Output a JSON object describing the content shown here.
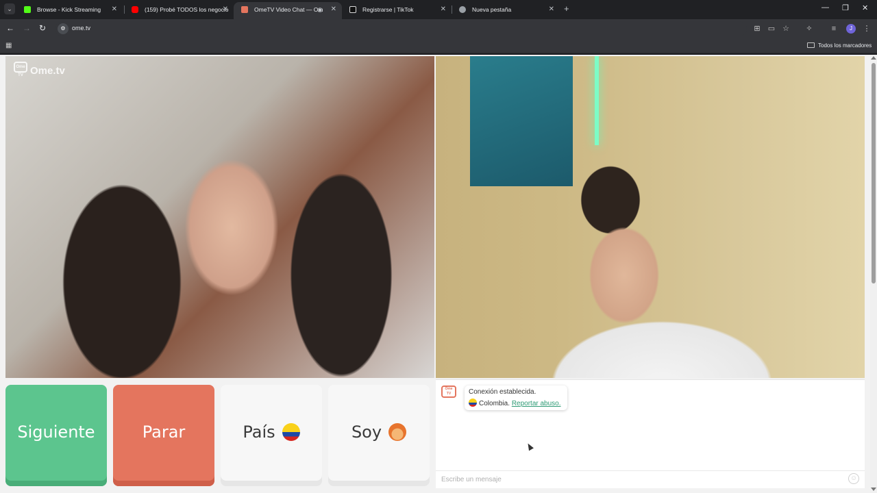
{
  "browser": {
    "tabs": [
      {
        "title": "Browse - Kick Streaming",
        "color": "#53fc18"
      },
      {
        "title": "(159) Probé TODOS los negocio",
        "color": "#ff0000"
      },
      {
        "title": "OmeTV Video Chat — Om",
        "color": "#e4755e"
      },
      {
        "title": "Registrarse | TikTok",
        "color": "#ffffff"
      },
      {
        "title": "Nueva pestaña",
        "color": "#9aa0a6"
      }
    ],
    "url": "ome.tv",
    "bookmarks_folder": "Todos los marcadores",
    "profile_initial": "J"
  },
  "site": {
    "logo_text": "Ome.tv",
    "logo_box": "Ome TV"
  },
  "controls": {
    "next": "Siguiente",
    "stop": "Parar",
    "country": "País",
    "gender": "Soy"
  },
  "chat": {
    "logo_box": "Ome TV",
    "connection": "Conexión establecida.",
    "country": "Colombia.",
    "report": "Reportar abuso.",
    "placeholder": "Escribe un mensaje"
  },
  "colors": {
    "next": "#5cc58e",
    "stop": "#e4755e",
    "link": "#2d9a74"
  }
}
